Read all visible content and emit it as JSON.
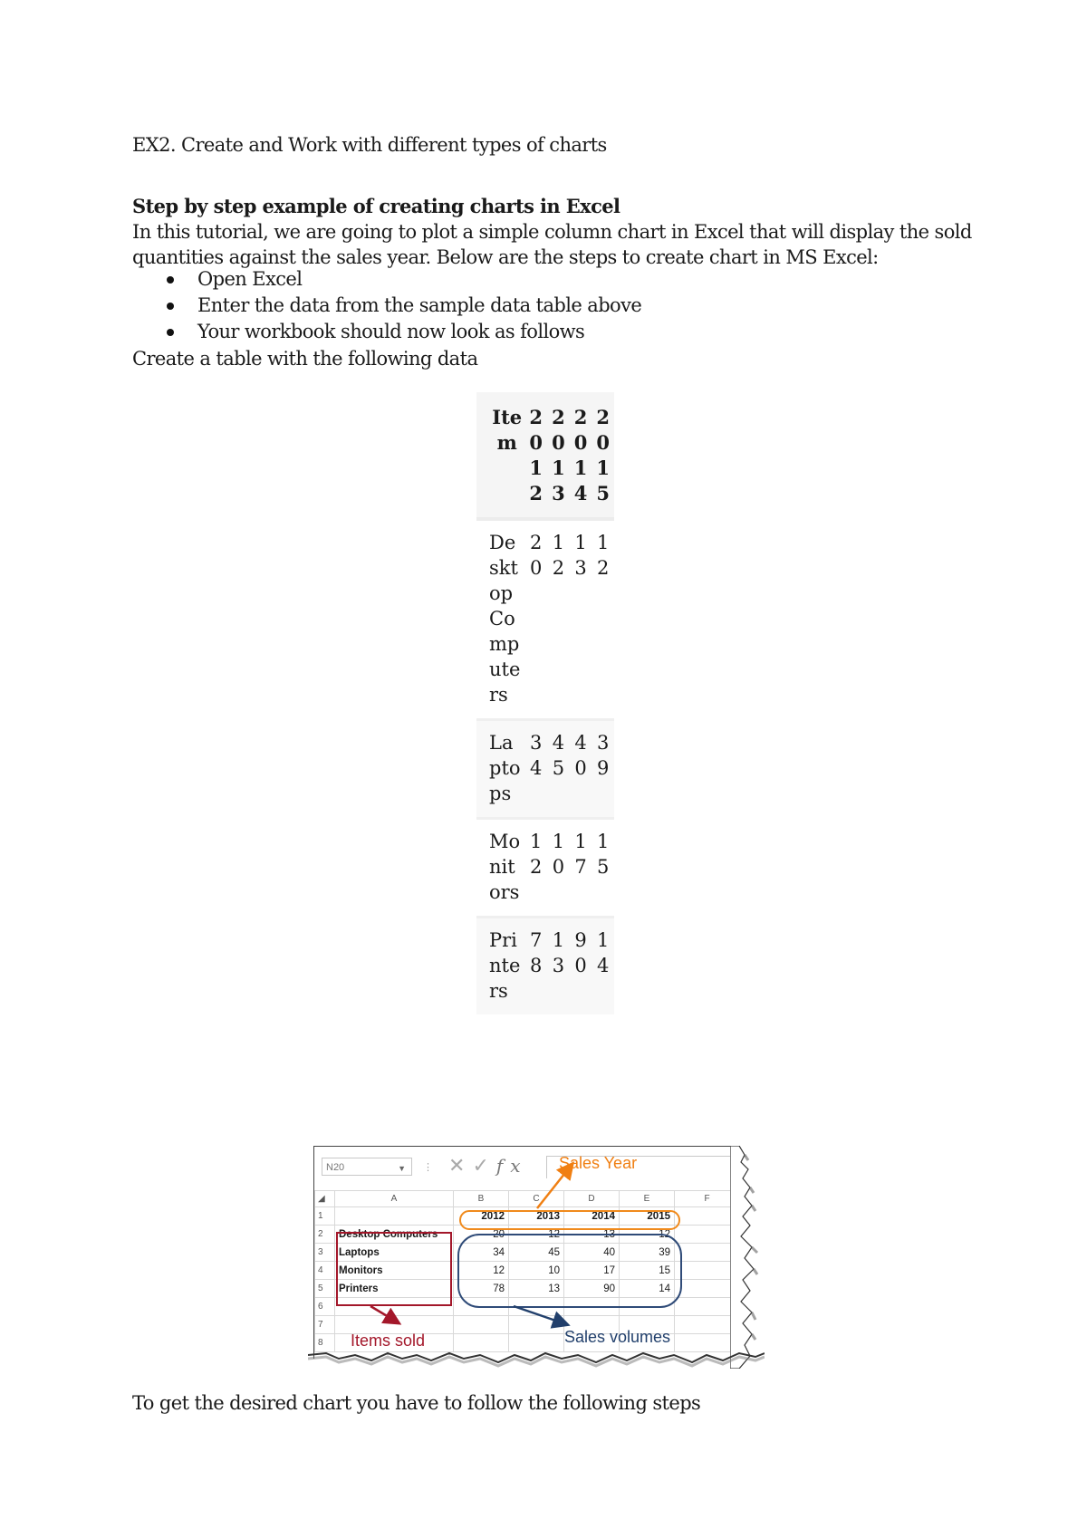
{
  "doc": {
    "title": "EX2. Create and Work with different types of charts",
    "heading": "Step by step example of creating charts in Excel",
    "intro_line1": "In this tutorial, we are going to plot a simple column chart in Excel that will display the sold",
    "intro_line2": "quantities against the sales year. Below are the steps to create chart in MS Excel:",
    "bullets": [
      "Open Excel",
      "Enter the data from the sample data table above",
      "Your workbook should now look as follows"
    ],
    "table_intro": "Create a table with the following data",
    "closing": "To get the desired chart you have to follow the following steps"
  },
  "table": {
    "headers": [
      "Item",
      "2012",
      "2013",
      "2014",
      "2015"
    ],
    "rows": [
      {
        "item": "Desktop Computers",
        "values": [
          "20",
          "12",
          "13",
          "12"
        ]
      },
      {
        "item": "Laptops",
        "values": [
          "34",
          "45",
          "40",
          "39"
        ]
      },
      {
        "item": "Monitors",
        "values": [
          "12",
          "10",
          "17",
          "15"
        ]
      },
      {
        "item": "Printers",
        "values": [
          "78",
          "13",
          "90",
          "14"
        ]
      }
    ]
  },
  "spreadsheet": {
    "name_box": "N20",
    "fx_label": "fx",
    "column_headers": [
      "A",
      "B",
      "C",
      "D",
      "E",
      "F"
    ],
    "row_numbers": [
      "1",
      "2",
      "3",
      "4",
      "5",
      "6",
      "7",
      "8"
    ],
    "years": [
      "2012",
      "2013",
      "2014",
      "2015"
    ],
    "rows": [
      {
        "item": "Desktop Computers",
        "values": [
          "20",
          "12",
          "13",
          "12"
        ]
      },
      {
        "item": "Laptops",
        "values": [
          "34",
          "45",
          "40",
          "39"
        ]
      },
      {
        "item": "Monitors",
        "values": [
          "12",
          "10",
          "17",
          "15"
        ]
      },
      {
        "item": "Printers",
        "values": [
          "78",
          "13",
          "90",
          "14"
        ]
      }
    ],
    "annotations": {
      "sales_year": "Sales Year",
      "items_sold": "Items sold",
      "sales_volumes": "Sales volumes"
    },
    "colors": {
      "sales_year": "#f07f12",
      "items_sold": "#a3172a",
      "sales_volumes": "#22406c"
    }
  }
}
